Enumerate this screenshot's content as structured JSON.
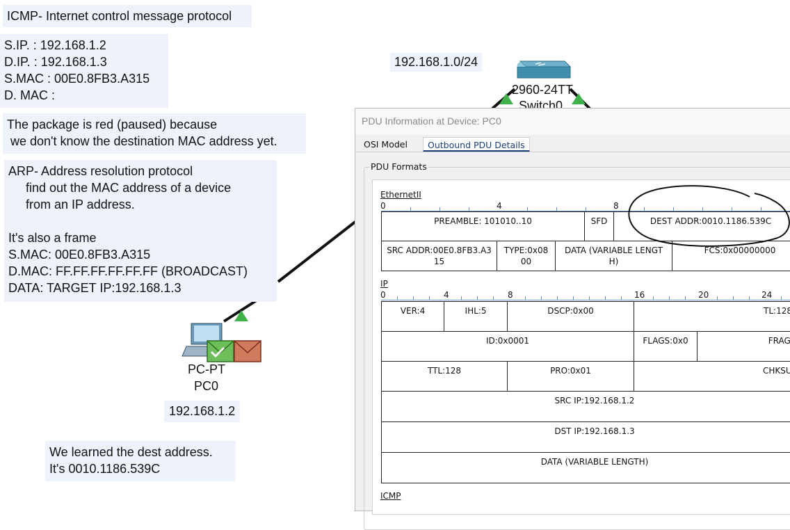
{
  "notes": {
    "icmp_title": "ICMP- Internet control message protocol",
    "addressing": "S.IP. : 192.168.1.2\nD.IP. : 192.168.1.3\nS.MAC : 00E0.8FB3.A315\nD. MAC :",
    "paused": "The package is red (paused) because\n we don't know the destination MAC address yet.",
    "arp": "ARP- Address resolution protocol\n     find out the MAC address of a device\n     from an IP address.\n\nIt's also a frame\nS.MAC: 00E0.8FB3.A315\nD.MAC: FF.FF.FF.FF.FF.FF (BROADCAST)\nDATA: TARGET IP:192.168.1.3",
    "learned": "We learned the dest address.\nIt's 0010.1186.539C"
  },
  "topology": {
    "network": "192.168.1.0/24",
    "switch_model": "2960-24TT",
    "switch_name": "Switch0",
    "pc_type": "PC-PT",
    "pc_name": "PC0",
    "pc_ip": "192.168.1.2",
    "link_color": "#111111",
    "port_up_color": "#3fb24a"
  },
  "dialog": {
    "title": "PDU Information at Device: PC0",
    "tabs": {
      "osi": "OSI Model",
      "outbound": "Outbound PDU Details"
    },
    "group_label": "PDU Formats",
    "ethernet": {
      "label": "EthernetII",
      "ruler": [
        "0",
        "4",
        "8"
      ],
      "preamble": "PREAMBLE: 101010..10",
      "sfd": "SFD",
      "dest": "DEST ADDR:0010.1186.539C",
      "src": "SRC ADDR:00E0.8FB3.A3\n15",
      "type": "TYPE:0x08\n00",
      "data": "DATA (VARIABLE LENGT\nH)",
      "fcs": "FCS:0x00000000"
    },
    "ip": {
      "label": "IP",
      "ruler": [
        "0",
        "4",
        "8",
        "16",
        "20",
        "24"
      ],
      "ver": "VER:4",
      "ihl": "IHL:5",
      "dscp": "DSCP:0x00",
      "tl": "TL:128",
      "id": "ID:0x0001",
      "flags": "FLAGS:0x0",
      "frag": "FRAG OF",
      "ttl": "TTL:128",
      "pro": "PRO:0x01",
      "chksum": "CHKSUM",
      "src": "SRC IP:192.168.1.2",
      "dst": "DST IP:192.168.1.3",
      "data": "DATA (VARIABLE LENGTH)"
    },
    "icmp_label": "ICMP",
    "accent": "#1a3d7a",
    "ruler_color": "#6a8fc7"
  }
}
